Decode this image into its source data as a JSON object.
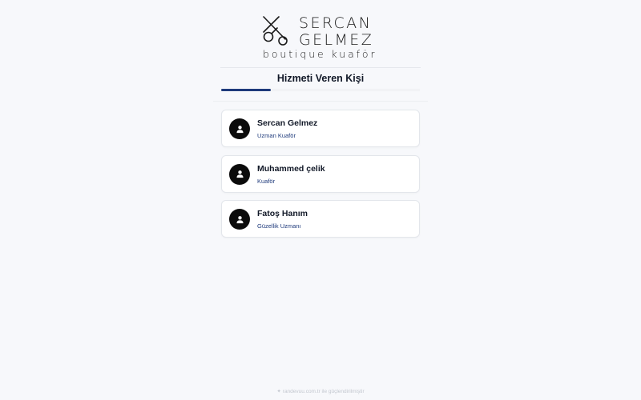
{
  "brand": {
    "name_line1": "SERCAN",
    "name_line2": "GELMEZ",
    "tagline": "boutique kuaför"
  },
  "step": {
    "title": "Hizmeti Veren Kişi",
    "progress": 0.25,
    "accent_color": "#1e3a7b"
  },
  "staff": [
    {
      "name": "Sercan Gelmez",
      "role": "Uzman Kuaför",
      "icon": "user-icon"
    },
    {
      "name": "Muhammed çelik",
      "role": "Kuaför",
      "icon": "user-icon"
    },
    {
      "name": "Fatoş Hanım",
      "role": "Güzellik Uzmanı",
      "icon": "user-icon"
    }
  ],
  "footer": {
    "icon": "sparkle-icon",
    "text": "randevuu.com.tr ile güçlendirilmiştir"
  }
}
